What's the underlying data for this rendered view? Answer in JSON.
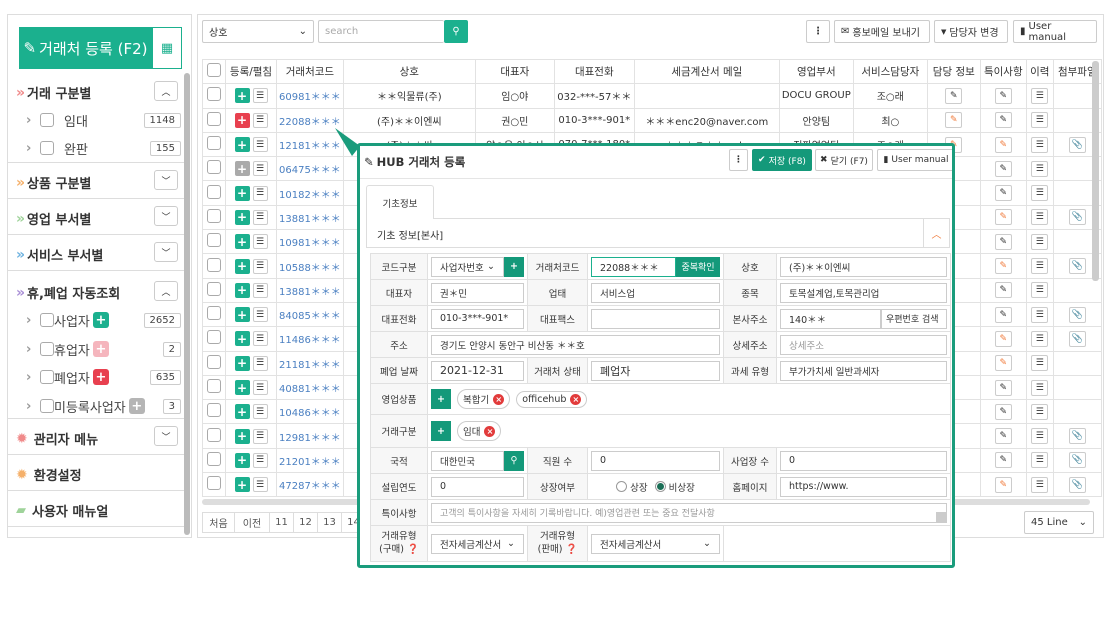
{
  "sidebar": {
    "register_button": "거래처 등록 (F2)",
    "sections": [
      {
        "title": "거래 구분별",
        "color": "#f08a8a",
        "expanded": true,
        "items": [
          {
            "label": "임대",
            "count": "1148"
          },
          {
            "label": "완판",
            "count": "155"
          }
        ]
      },
      {
        "title": "상품 구분별",
        "color": "#f5b06a",
        "expanded": false
      },
      {
        "title": "영업 부서별",
        "color": "#9fd39a",
        "expanded": false
      },
      {
        "title": "서비스 부서별",
        "color": "#6fb3e0",
        "expanded": false
      },
      {
        "title": "휴,폐업 자동조회",
        "color": "#a98fd6",
        "expanded": true,
        "items": [
          {
            "label": "사업자",
            "count": "2652",
            "badge_color": "#1bb08e"
          },
          {
            "label": "휴업자",
            "count": "2",
            "badge_color": "#f5b5bd"
          },
          {
            "label": "폐업자",
            "count": "635",
            "badge_color": "#e8404f"
          },
          {
            "label": "미등록사업자",
            "count": "3",
            "badge_color": "#b5b5b5"
          }
        ]
      }
    ],
    "admin_menu": "관리자 메뉴",
    "settings": "환경설정",
    "user_manual": "사용자 매뉴얼"
  },
  "toolbar": {
    "search_field_select": "상호",
    "search_placeholder": "search",
    "more": "⋮",
    "send_mail": "홍보메일 보내기",
    "change_manager": "담당자 변경",
    "user_manual": "User manual"
  },
  "table": {
    "headers": [
      "등록/펼침",
      "거래처코드",
      "상호",
      "대표자",
      "대표전화",
      "세금계산서 메일",
      "영업부서",
      "서비스담당자",
      "담당 정보",
      "특이사항",
      "이력",
      "첨부파일"
    ],
    "rows": [
      {
        "code": "60981＊＊＊",
        "name": "＊＊익물류(주)",
        "ceo": "임○야",
        "phone": "032-***-57＊＊",
        "email": "",
        "dept": "DOCU GROUP",
        "svc": "조○래",
        "plus": "green",
        "info": "black",
        "note": "black",
        "attach": false
      },
      {
        "code": "22088＊＊＊",
        "name": "(주)＊＊이엔씨",
        "ceo": "권○민",
        "phone": "010-3***-901*",
        "email": "＊＊＊enc20@naver.com",
        "dept": "안양팀",
        "svc": "최○",
        "plus": "red",
        "info": "orange",
        "note": "black",
        "attach": false
      },
      {
        "code": "12181＊＊＊",
        "name": "(주)＊＊씨",
        "ceo": "양○용,이○시",
        "phone": "070-7***-180*",
        "email": "＊＊＊@＊＊co.kr",
        "dept": "진파영업팀",
        "svc": "조○래",
        "plus": "green",
        "info": "orange",
        "note": "orange",
        "attach": true
      },
      {
        "code": "06475＊＊＊",
        "plus": "gray",
        "note": "black",
        "attach": false
      },
      {
        "code": "10182＊＊＊",
        "plus": "green",
        "note": "black",
        "attach": false
      },
      {
        "code": "13881＊＊＊",
        "plus": "green",
        "note": "orange",
        "attach": true
      },
      {
        "code": "10981＊＊＊",
        "plus": "green",
        "note": "black",
        "attach": false
      },
      {
        "code": "10588＊＊＊",
        "plus": "green",
        "note": "orange",
        "attach": true
      },
      {
        "code": "13881＊＊＊",
        "plus": "green",
        "note": "black",
        "attach": false
      },
      {
        "code": "84085＊＊＊",
        "plus": "green",
        "note": "black",
        "attach": true
      },
      {
        "code": "11486＊＊＊",
        "plus": "green",
        "note": "orange",
        "attach": true
      },
      {
        "code": "21181＊＊＊",
        "plus": "green",
        "note": "orange",
        "attach": false
      },
      {
        "code": "40881＊＊＊",
        "plus": "green",
        "note": "black",
        "attach": false
      },
      {
        "code": "10486＊＊＊",
        "plus": "green",
        "note": "black",
        "attach": false
      },
      {
        "code": "12981＊＊＊",
        "plus": "green",
        "note": "black",
        "attach": true
      },
      {
        "code": "21201＊＊＊",
        "plus": "green",
        "note": "black",
        "attach": true
      },
      {
        "code": "47287＊＊＊",
        "plus": "green",
        "note": "orange",
        "attach": true
      }
    ]
  },
  "pagination": {
    "first": "처음",
    "prev": "이전",
    "pages": [
      "11",
      "12",
      "13",
      "14"
    ],
    "lines": "45 Line"
  },
  "modal": {
    "title": "HUB 거래처 등록",
    "more": "⋮",
    "save": "저장 (F8)",
    "close": "닫기 (F7)",
    "user_manual": "User manual",
    "tab": "기초정보",
    "section_title": "기초 정보[본사]",
    "fields": {
      "code_type_label": "코드구분",
      "code_type": "사업자번호",
      "client_code_label": "거래처코드",
      "client_code": "22088＊＊＊",
      "dup_check": "중복확인",
      "company_label": "상호",
      "company": "(주)＊＊이엔씨",
      "ceo_label": "대표자",
      "ceo": "권＊민",
      "biz_type_label": "업태",
      "biz_type": "서비스업",
      "biz_item_label": "종목",
      "biz_item": "토목설계업,토목관리업",
      "phone_label": "대표전화",
      "phone": "010-3***-901*",
      "fax_label": "대표팩스",
      "fax": "",
      "hq_addr_label": "본사주소",
      "zip": "140＊＊",
      "zip_search": "우편번호 검색",
      "addr_label": "주소",
      "addr": "경기도 안양시 동안구 비산동 ＊＊호",
      "addr_detail_label": "상세주소",
      "addr_detail_placeholder": "상세주소",
      "close_date_label": "폐업 날짜",
      "close_date": "2021-12-31",
      "status_label": "거래처 상태",
      "status": "폐업자",
      "tax_type_label": "과세 유형",
      "tax_type": "부가가치세 일반과세자",
      "products_label": "영업상품",
      "products": [
        "복합기",
        "officehub"
      ],
      "deal_type_label": "거래구분",
      "deal_types": [
        "임대"
      ],
      "country_label": "국적",
      "country": "대한민국",
      "employees_label": "직원 수",
      "employees": "0",
      "sites_label": "사업장 수",
      "sites": "0",
      "founded_label": "설립연도",
      "founded": "0",
      "listed_label": "상장여부",
      "listed_opt": "상장",
      "unlisted_opt": "비상장",
      "listed_value": "비상장",
      "homepage_label": "홈페이지",
      "homepage": "https://www.",
      "note_label": "특이사항",
      "note_placeholder": "고객의 특이사항을 자세히 기록바랍니다. 예)영업관련 또는 중요 전달사항",
      "buy_type_label": "거래유형",
      "buy_type_sub": "(구매)",
      "buy_type": "전자세금계산서",
      "sell_type_label": "거래유형",
      "sell_type_sub": "(판매)",
      "sell_type": "전자세금계산서"
    }
  },
  "colors": {
    "accent": "#1bb08e",
    "modal_border": "#1a9c7c",
    "red": "#e8404f",
    "orange": "#f07a3a"
  }
}
